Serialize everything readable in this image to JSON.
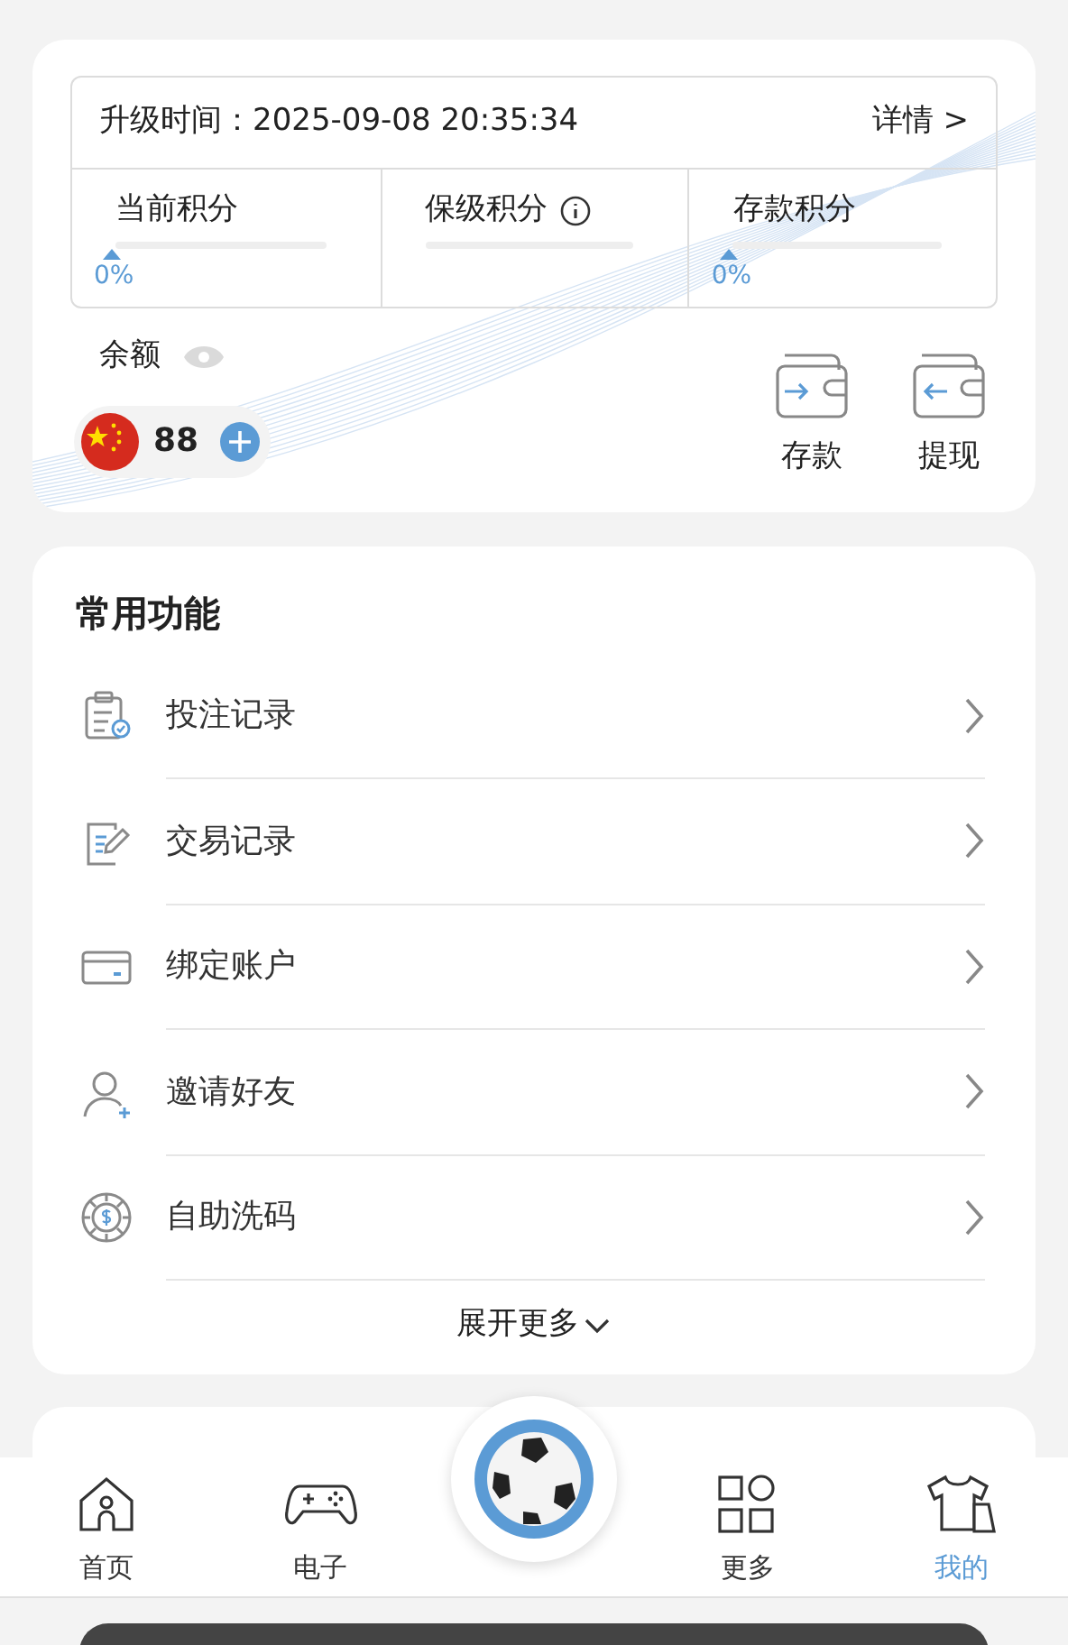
{
  "upgrade": {
    "label": "升级时间：2025-09-08 20:35:34",
    "details": "详情 >"
  },
  "points": [
    {
      "label": "当前积分",
      "info": false,
      "reading": "0%"
    },
    {
      "label": "保级积分",
      "info": true
    },
    {
      "label": "存款积分",
      "info": false,
      "reading": "0%"
    }
  ],
  "balance": {
    "label": "余额",
    "amount": "88"
  },
  "wallet_actions": [
    {
      "kind": "deposit",
      "label": "存款"
    },
    {
      "kind": "withdraw",
      "label": "提现"
    }
  ],
  "functions": {
    "title": "常用功能",
    "items": [
      {
        "kind": "bets",
        "label": "投注记录"
      },
      {
        "kind": "transactions",
        "label": "交易记录"
      },
      {
        "kind": "card",
        "label": "绑定账户"
      },
      {
        "kind": "invite",
        "label": "邀请好友"
      },
      {
        "kind": "chip",
        "label": "自助洗码"
      }
    ],
    "expand": "展开更多"
  },
  "nav": [
    {
      "kind": "home",
      "label": "首页",
      "selected": false
    },
    {
      "kind": "games",
      "label": "电子",
      "selected": false
    },
    {
      "kind": "ball"
    },
    {
      "kind": "more",
      "label": "更多",
      "selected": false
    },
    {
      "kind": "profile",
      "label": "我的",
      "selected": true
    }
  ]
}
